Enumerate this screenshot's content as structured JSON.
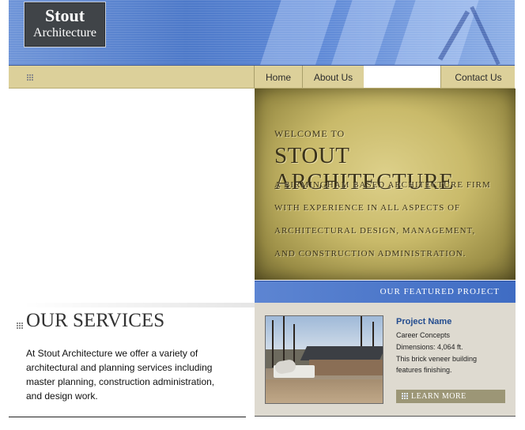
{
  "logo": {
    "line1": "Stout",
    "line2": "Architecture"
  },
  "nav": {
    "home": "Home",
    "about": "About Us",
    "contact": "Contact Us"
  },
  "welcome": {
    "small": "WELCOME TO",
    "title": "STOUT ARCHITECTURE",
    "lines": [
      "A BIRMINGHAM BASED ARCHITECTURE FIRM",
      "WITH EXPERIENCE IN ALL ASPECTS OF",
      "ARCHITECTURAL DESIGN, MANAGEMENT,",
      "AND CONSTRUCTION ADMINISTRATION."
    ]
  },
  "featured": {
    "header": "OUR FEATURED PROJECT",
    "project_name": "Project Name",
    "lines": [
      "Career Concepts",
      "Dimensions: 4,064 ft.",
      "This brick veneer building",
      "features finishing."
    ],
    "learn_more": "LEARN MORE"
  },
  "services": {
    "title": "OUR SERVICES",
    "text": "At Stout Architecture we offer a variety of architectural and planning services including master planning, construction administration, and design work."
  },
  "colors": {
    "banner_blue": "#4d79c9",
    "nav_tan": "#dcd09a",
    "featured_blue": "#3f6cc3",
    "project_name": "#234c8f"
  }
}
